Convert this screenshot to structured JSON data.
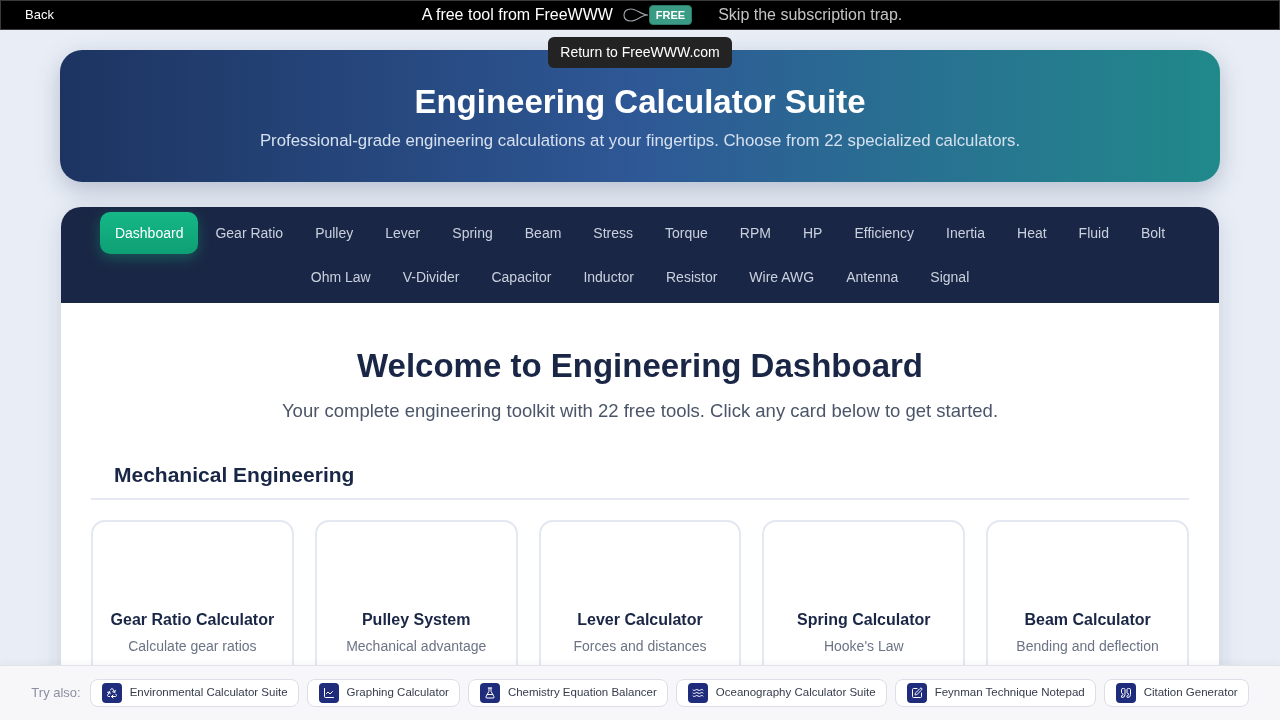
{
  "top_bar": {
    "back": "Back",
    "tagline": "A free tool from FreeWWW",
    "logo_text": "FREE",
    "slogan": "Skip the subscription trap.",
    "tooltip": "Return to FreeWWW.com"
  },
  "header": {
    "title": "Engineering Calculator Suite",
    "subtitle": "Professional-grade engineering calculations at your fingertips. Choose from 22 specialized calculators."
  },
  "nav_tabs": [
    {
      "label": "Dashboard",
      "selected": true
    },
    {
      "label": "Gear Ratio",
      "selected": false
    },
    {
      "label": "Pulley",
      "selected": false
    },
    {
      "label": "Lever",
      "selected": false
    },
    {
      "label": "Spring",
      "selected": false
    },
    {
      "label": "Beam",
      "selected": false
    },
    {
      "label": "Stress",
      "selected": false
    },
    {
      "label": "Torque",
      "selected": false
    },
    {
      "label": "RPM",
      "selected": false
    },
    {
      "label": "HP",
      "selected": false
    },
    {
      "label": "Efficiency",
      "selected": false
    },
    {
      "label": "Inertia",
      "selected": false
    },
    {
      "label": "Heat",
      "selected": false
    },
    {
      "label": "Fluid",
      "selected": false
    },
    {
      "label": "Bolt",
      "selected": false
    },
    {
      "label": "Ohm Law",
      "selected": false
    },
    {
      "label": "V-Divider",
      "selected": false
    },
    {
      "label": "Capacitor",
      "selected": false
    },
    {
      "label": "Inductor",
      "selected": false
    },
    {
      "label": "Resistor",
      "selected": false
    },
    {
      "label": "Wire AWG",
      "selected": false
    },
    {
      "label": "Antenna",
      "selected": false
    },
    {
      "label": "Signal",
      "selected": false
    }
  ],
  "welcome": {
    "title": "Welcome to Engineering Dashboard",
    "subtitle": "Your complete engineering toolkit with 22 free tools. Click any card below to get started."
  },
  "sections": [
    {
      "heading": "Mechanical Engineering",
      "cards": [
        {
          "title": "Gear Ratio Calculator",
          "description": "Calculate gear ratios"
        },
        {
          "title": "Pulley System",
          "description": "Mechanical advantage"
        },
        {
          "title": "Lever Calculator",
          "description": "Forces and distances"
        },
        {
          "title": "Spring Calculator",
          "description": "Hooke's Law"
        },
        {
          "title": "Beam Calculator",
          "description": "Bending and deflection"
        }
      ]
    }
  ],
  "try_also": {
    "label": "Try also:",
    "links": [
      {
        "label": "Environmental Calculator Suite"
      },
      {
        "label": "Graphing Calculator"
      },
      {
        "label": "Chemistry Equation Balancer"
      },
      {
        "label": "Oceanography Calculator Suite"
      },
      {
        "label": "Feynman Technique Notepad"
      },
      {
        "label": "Citation Generator"
      }
    ]
  }
}
